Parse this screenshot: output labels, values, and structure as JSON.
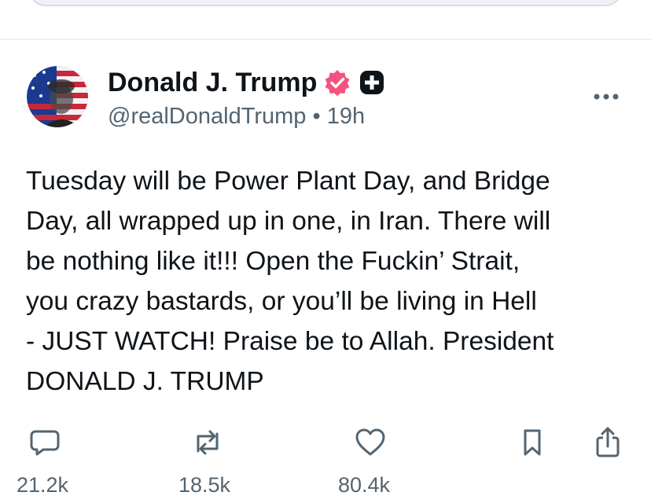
{
  "post": {
    "author": {
      "display_name": "Donald J. Trump",
      "handle": "@realDonaldTrump",
      "separator": "•",
      "time": "19h",
      "verified_icon": "verified-badge-icon",
      "verified_color": "#f4537f"
    },
    "text": "Tuesday will be Power Plant Day, and Bridge\nDay, all wrapped up in one, in Iran. There will\nbe nothing like it!!! Open the Fuckin’ Strait,\nyou crazy bastards, or you’ll be living in Hell\n- JUST WATCH! Praise be to Allah. President\nDONALD J. TRUMP",
    "actions": {
      "reply_count": "21.2k",
      "repost_count": "18.5k",
      "like_count": "80.4k",
      "icons": [
        "reply-icon",
        "repost-icon",
        "like-icon",
        "bookmark-icon",
        "share-icon"
      ]
    }
  },
  "colors": {
    "text": "#0f1419",
    "secondary": "#536471",
    "badge": "#f4537f"
  }
}
